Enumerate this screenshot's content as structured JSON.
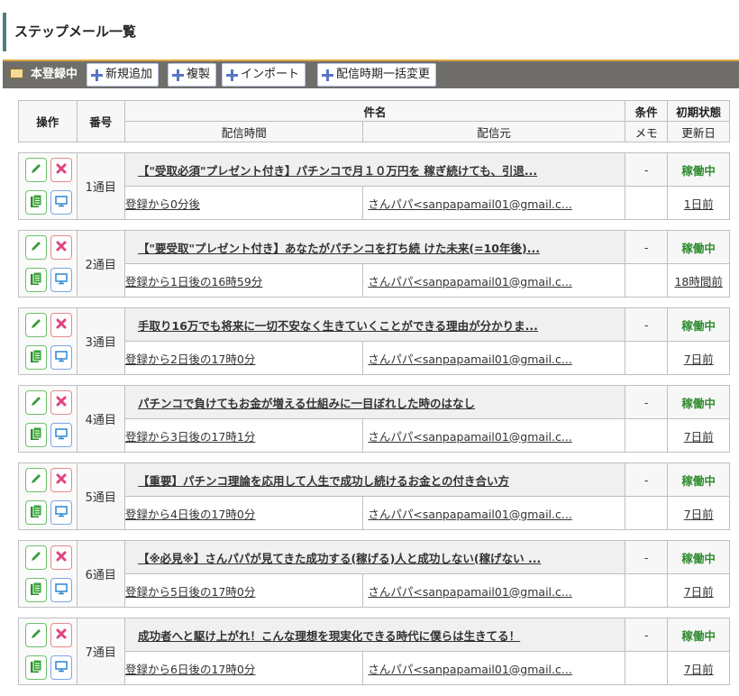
{
  "page": {
    "title": "ステップメール一覧"
  },
  "toolbar": {
    "label": "本登録中",
    "buttons": [
      "新規追加",
      "複製",
      "インポート",
      "配信時期一括変更"
    ]
  },
  "table": {
    "headers": {
      "ops": "操作",
      "num": "番号",
      "subject": "件名",
      "cond": "条件",
      "status": "初期状態",
      "timing": "配信時間",
      "from": "配信元",
      "memo": "メモ",
      "updated": "更新日"
    },
    "rows": [
      {
        "num": "1通目",
        "subject": "【\"受取必須\"プレゼント付き】パチンコで月１０万円を 稼ぎ続けても、引退...",
        "cond": "-",
        "status": "稼働中",
        "timing": "登録から0分後",
        "from": "さんパパ<sanpapamail01@gmail.c...",
        "memo": "",
        "updated": "1日前"
      },
      {
        "num": "2通目",
        "subject": "【\"要受取\"プレゼント付き】あなたがパチンコを打ち続 けた未来(=10年後)...",
        "cond": "-",
        "status": "稼働中",
        "timing": "登録から1日後の16時59分",
        "from": "さんパパ<sanpapamail01@gmail.c...",
        "memo": "",
        "updated": "18時間前"
      },
      {
        "num": "3通目",
        "subject": "手取り16万でも将来に一切不安なく生きていくことができる理由が分かりま...",
        "cond": "-",
        "status": "稼働中",
        "timing": "登録から2日後の17時0分",
        "from": "さんパパ<sanpapamail01@gmail.c...",
        "memo": "",
        "updated": "7日前"
      },
      {
        "num": "4通目",
        "subject": "パチンコで負けてもお金が増える仕組みに一目ぼれした時のはなし",
        "cond": "-",
        "status": "稼働中",
        "timing": "登録から3日後の17時1分",
        "from": "さんパパ<sanpapamail01@gmail.c...",
        "memo": "",
        "updated": "7日前"
      },
      {
        "num": "5通目",
        "subject": "【重要】パチンコ理論を応用して人生で成功し続けるお金との付き合い方",
        "cond": "-",
        "status": "稼働中",
        "timing": "登録から4日後の17時0分",
        "from": "さんパパ<sanpapamail01@gmail.c...",
        "memo": "",
        "updated": "7日前"
      },
      {
        "num": "6通目",
        "subject": "【※必見※】さんパパが見てきた成功する(稼げる)人と成功しない(稼げない ...",
        "cond": "-",
        "status": "稼働中",
        "timing": "登録から5日後の17時0分",
        "from": "さんパパ<sanpapamail01@gmail.c...",
        "memo": "",
        "updated": "7日前"
      },
      {
        "num": "7通目",
        "subject": "成功者へと駆け上がれ！こんな理想を現実化できる時代に僕らは生きてる！",
        "cond": "-",
        "status": "稼働中",
        "timing": "登録から6日後の17時0分",
        "from": "さんパパ<sanpapamail01@gmail.c...",
        "memo": "",
        "updated": "7日前"
      }
    ]
  },
  "icons": {
    "edit": "pencil-icon",
    "delete": "x-icon",
    "copy": "document-copy-icon",
    "preview": "monitor-icon",
    "toolbar": "envelope-icon",
    "add": "plus-icon"
  },
  "colors": {
    "status": "#2e8b2e",
    "toolbar_bg": "#6f6e6a",
    "accent_bar": "#4d7f83"
  }
}
